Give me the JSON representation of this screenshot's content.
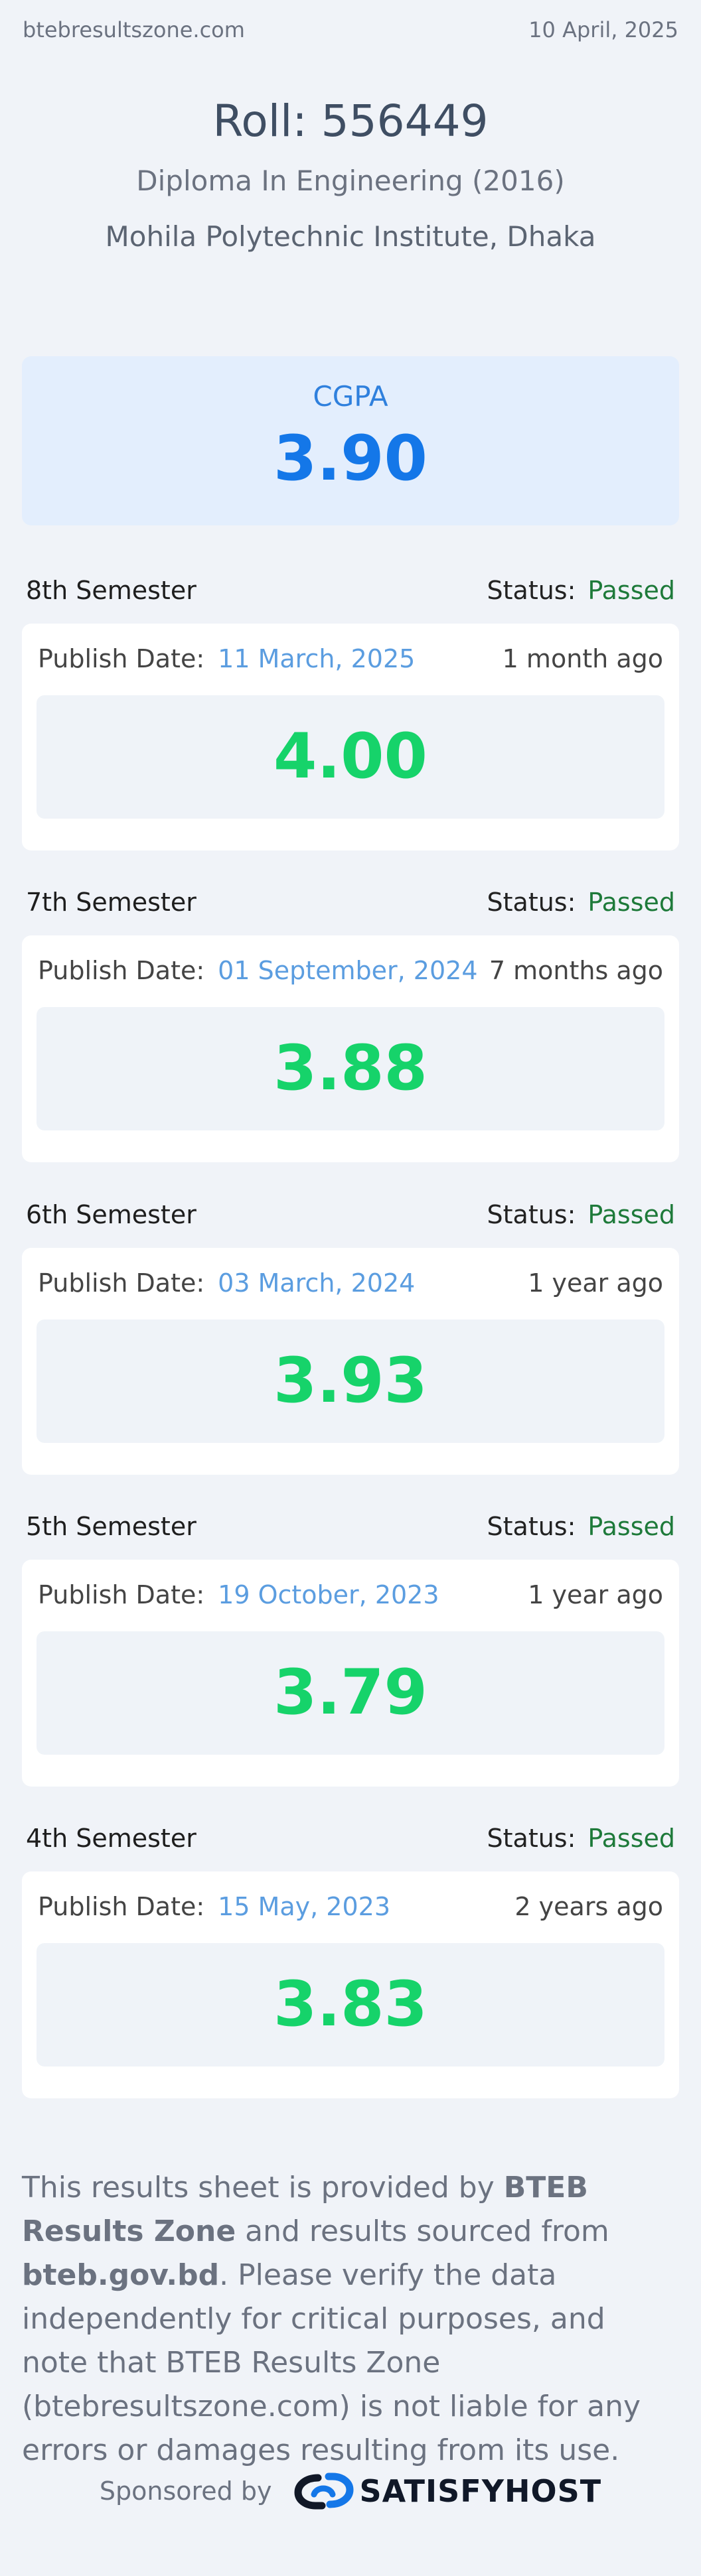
{
  "topbar": {
    "site": "btebresultszone.com",
    "date": "10 April, 2025"
  },
  "header": {
    "roll": "Roll: 556449",
    "program": "Diploma In Engineering (2016)",
    "institute": "Mohila Polytechnic Institute, Dhaka"
  },
  "cgpa": {
    "label": "CGPA",
    "value": "3.90"
  },
  "semesters": [
    {
      "name": "8th Semester",
      "status_label": "Status:",
      "status": "Passed",
      "publish_label": "Publish Date:",
      "publish_date": "11 March, 2025",
      "ago": "1 month ago",
      "gpa": "4.00"
    },
    {
      "name": "7th Semester",
      "status_label": "Status:",
      "status": "Passed",
      "publish_label": "Publish Date:",
      "publish_date": "01 September, 2024",
      "ago": "7 months ago",
      "gpa": "3.88"
    },
    {
      "name": "6th Semester",
      "status_label": "Status:",
      "status": "Passed",
      "publish_label": "Publish Date:",
      "publish_date": "03 March, 2024",
      "ago": "1 year ago",
      "gpa": "3.93"
    },
    {
      "name": "5th Semester",
      "status_label": "Status:",
      "status": "Passed",
      "publish_label": "Publish Date:",
      "publish_date": "19 October, 2023",
      "ago": "1 year ago",
      "gpa": "3.79"
    },
    {
      "name": "4th Semester",
      "status_label": "Status:",
      "status": "Passed",
      "publish_label": "Publish Date:",
      "publish_date": "15 May, 2023",
      "ago": "2 years ago",
      "gpa": "3.83"
    }
  ],
  "disclaimer": {
    "part1": "This results sheet is provided by ",
    "brand": "BTEB Results Zone",
    "part2": " and results sourced from ",
    "source": "bteb.gov.bd",
    "part3": ". Please verify the data independently for critical purposes, and note that BTEB Results Zone (btebresultszone.com) is not liable for any errors or damages resulting from its use."
  },
  "sponsor": {
    "label": "Sponsored by",
    "name": "SATISFYHOST",
    "logo_icon": "satisfyhost-logo-icon"
  },
  "colors": {
    "accent": "#1477e8",
    "gpa": "#16d36a",
    "passed": "#1e7a3a",
    "date": "#5b9de0"
  }
}
